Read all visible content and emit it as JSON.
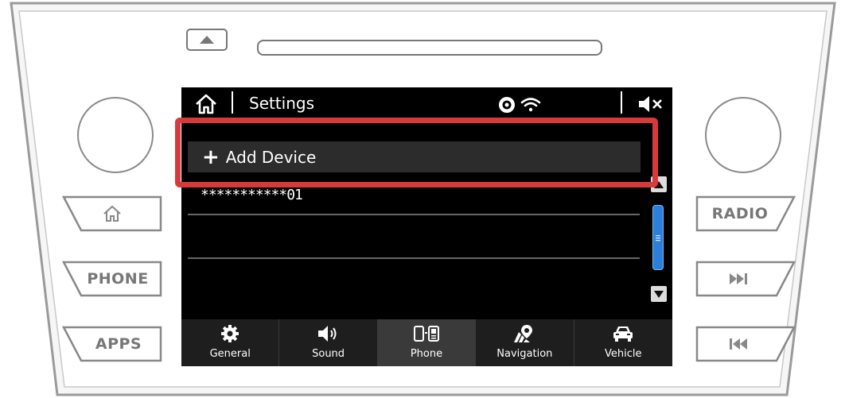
{
  "header": {
    "title": "Settings"
  },
  "list": {
    "add_device_label": "Add Device",
    "devices": [
      {
        "name": "***********01"
      }
    ]
  },
  "hardware": {
    "left_buttons": [
      "PHONE",
      "APPS"
    ],
    "right_buttons": [
      "RADIO"
    ]
  },
  "tabs": [
    {
      "label": "General",
      "icon": "gear-icon"
    },
    {
      "label": "Sound",
      "icon": "speaker-icon"
    },
    {
      "label": "Phone",
      "icon": "phone-icon",
      "active": true
    },
    {
      "label": "Navigation",
      "icon": "map-pin-icon"
    },
    {
      "label": "Vehicle",
      "icon": "car-icon"
    }
  ],
  "colors": {
    "highlight": "#d73a3a",
    "scroll_thumb": "#2b7fd8",
    "screen_bg": "#000000"
  }
}
